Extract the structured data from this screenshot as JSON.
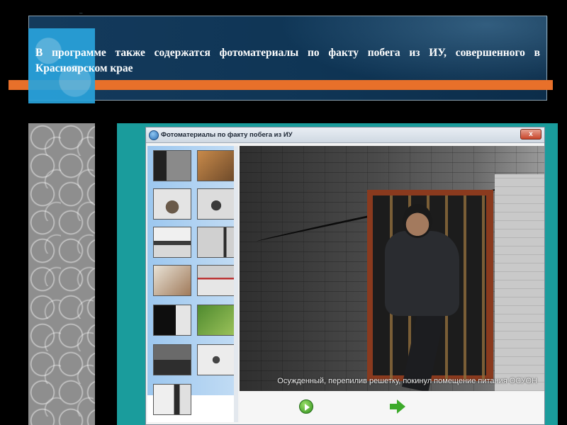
{
  "slide": {
    "corner_mark": "–",
    "title": "В программе также содержатся фотоматериалы по факту побега из ИУ, совершенного в Красноярском крае"
  },
  "window": {
    "title": "Фотоматериалы по факту побега из ИУ",
    "close_label": "x"
  },
  "viewer": {
    "caption": "Осужденный, перепилив решетку, покинул помещение питания ОСУОН",
    "thumbnail_count": 13
  },
  "colors": {
    "title_band": "#143a5c",
    "accent_blue": "#29a3dc",
    "accent_orange": "#e8702a",
    "frame_teal": "#1a9c9c",
    "nav_green": "#3caa2a"
  },
  "icons": {
    "app": "app-icon",
    "close": "close-icon",
    "play": "play-icon",
    "next": "next-arrow-icon"
  }
}
